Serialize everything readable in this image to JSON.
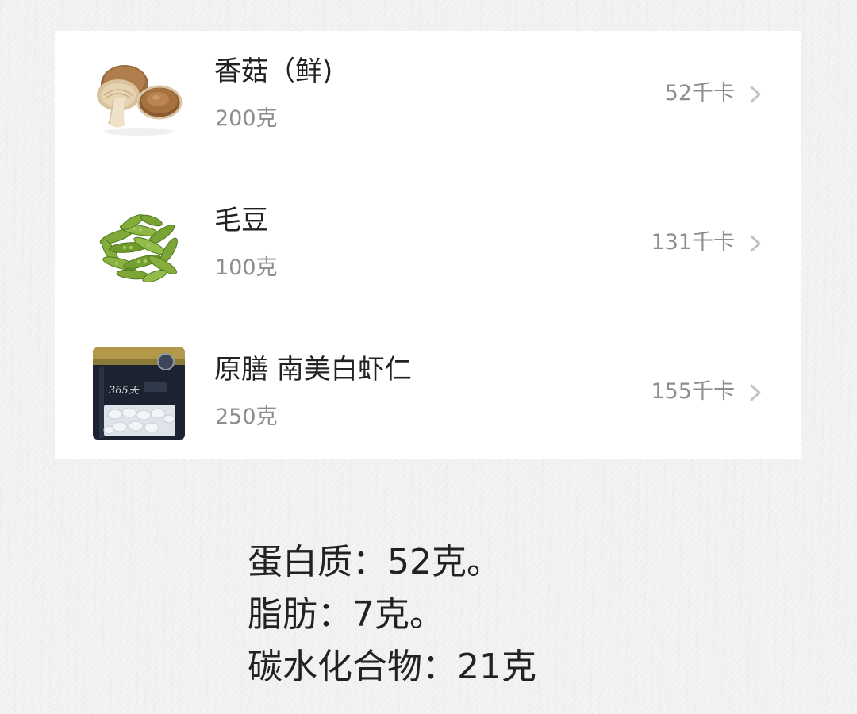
{
  "food_list": {
    "items": [
      {
        "name": "香菇（鲜)",
        "amount": "200克",
        "calories": "52千卡",
        "thumb_icon": "shiitake-mushroom-image"
      },
      {
        "name": "毛豆",
        "amount": "100克",
        "calories": "131千卡",
        "thumb_icon": "edamame-image"
      },
      {
        "name": "原膳 南美白虾仁",
        "amount": "250克",
        "calories": "155千卡",
        "thumb_icon": "shrimp-package-image",
        "package_text": "365天"
      }
    ]
  },
  "nutrition_summary": {
    "protein": {
      "label": "蛋白质：",
      "value": "52克。"
    },
    "fat": {
      "label": "脂肪：",
      "value": "7克。"
    },
    "carbs": {
      "label": "碳水化合物：",
      "value": "21克"
    }
  },
  "colors": {
    "card_background": "#ffffff",
    "page_background": "#f2f2f0",
    "primary_text": "#222222",
    "secondary_text": "#8e8e8e",
    "chevron": "#c4c4c4"
  }
}
